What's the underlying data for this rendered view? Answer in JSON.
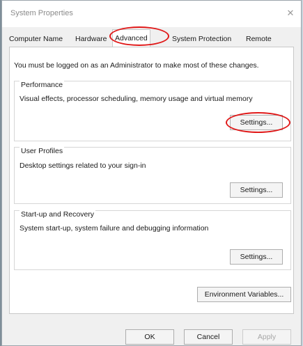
{
  "window": {
    "title": "System Properties",
    "close_glyph": "✕"
  },
  "tabs": [
    {
      "label": "Computer Name",
      "active": false
    },
    {
      "label": "Hardware",
      "active": false
    },
    {
      "label": "Advanced",
      "active": true
    },
    {
      "label": "System Protection",
      "active": false
    },
    {
      "label": "Remote",
      "active": false
    }
  ],
  "notice": "You must be logged on as an Administrator to make most of these changes.",
  "performance": {
    "title": "Performance",
    "description": "Visual effects, processor scheduling, memory usage and virtual memory",
    "button": "Settings..."
  },
  "user_profiles": {
    "title": "User Profiles",
    "description": "Desktop settings related to your sign-in",
    "button": "Settings..."
  },
  "startup_recovery": {
    "title": "Start-up and Recovery",
    "description": "System start-up, system failure and debugging information",
    "button": "Settings..."
  },
  "environment_button": "Environment Variables...",
  "footer": {
    "ok": "OK",
    "cancel": "Cancel",
    "apply": "Apply"
  },
  "annotation_color": "#e01818"
}
